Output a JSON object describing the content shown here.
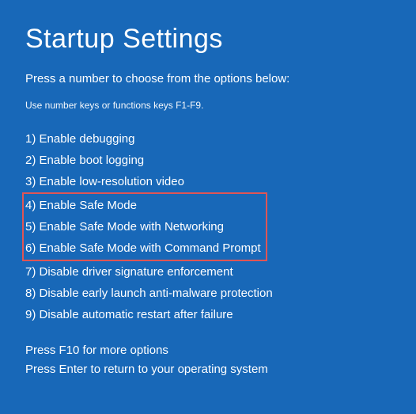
{
  "title": "Startup Settings",
  "subtitle": "Press a number to choose from the options below:",
  "hint": "Use number keys or functions keys F1-F9.",
  "options": [
    {
      "num": "1",
      "label": "Enable debugging",
      "highlighted": false
    },
    {
      "num": "2",
      "label": "Enable boot logging",
      "highlighted": false
    },
    {
      "num": "3",
      "label": "Enable low-resolution video",
      "highlighted": false
    },
    {
      "num": "4",
      "label": "Enable Safe Mode",
      "highlighted": true
    },
    {
      "num": "5",
      "label": "Enable Safe Mode with Networking",
      "highlighted": true
    },
    {
      "num": "6",
      "label": "Enable Safe Mode with Command Prompt",
      "highlighted": true
    },
    {
      "num": "7",
      "label": "Disable driver signature enforcement",
      "highlighted": false
    },
    {
      "num": "8",
      "label": "Disable early launch anti-malware protection",
      "highlighted": false
    },
    {
      "num": "9",
      "label": "Disable automatic restart after failure",
      "highlighted": false
    }
  ],
  "footer": {
    "line1": "Press F10 for more options",
    "line2": "Press Enter to return to your operating system"
  },
  "colors": {
    "background": "#1868b8",
    "text": "#ffffff",
    "highlight_border": "#e05555"
  }
}
